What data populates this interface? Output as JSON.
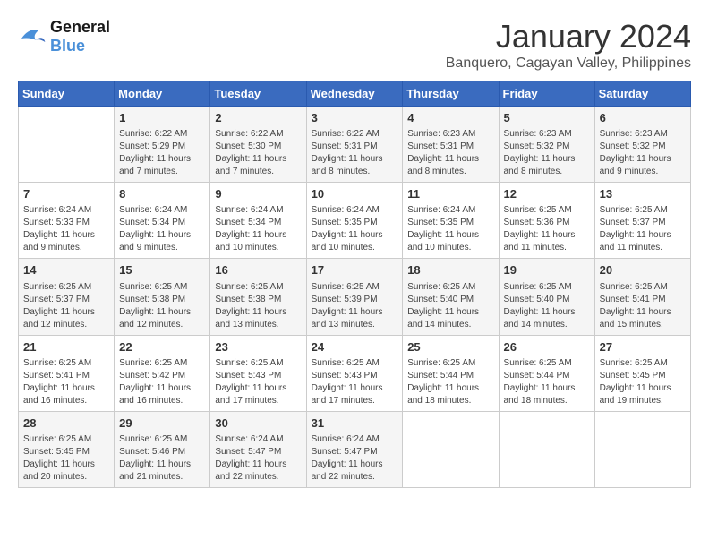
{
  "header": {
    "logo_line1": "General",
    "logo_line2": "Blue",
    "month_year": "January 2024",
    "location": "Banquero, Cagayan Valley, Philippines"
  },
  "columns": [
    "Sunday",
    "Monday",
    "Tuesday",
    "Wednesday",
    "Thursday",
    "Friday",
    "Saturday"
  ],
  "weeks": [
    [
      {
        "day": "",
        "sunrise": "",
        "sunset": "",
        "daylight": ""
      },
      {
        "day": "1",
        "sunrise": "Sunrise: 6:22 AM",
        "sunset": "Sunset: 5:29 PM",
        "daylight": "Daylight: 11 hours and 7 minutes."
      },
      {
        "day": "2",
        "sunrise": "Sunrise: 6:22 AM",
        "sunset": "Sunset: 5:30 PM",
        "daylight": "Daylight: 11 hours and 7 minutes."
      },
      {
        "day": "3",
        "sunrise": "Sunrise: 6:22 AM",
        "sunset": "Sunset: 5:31 PM",
        "daylight": "Daylight: 11 hours and 8 minutes."
      },
      {
        "day": "4",
        "sunrise": "Sunrise: 6:23 AM",
        "sunset": "Sunset: 5:31 PM",
        "daylight": "Daylight: 11 hours and 8 minutes."
      },
      {
        "day": "5",
        "sunrise": "Sunrise: 6:23 AM",
        "sunset": "Sunset: 5:32 PM",
        "daylight": "Daylight: 11 hours and 8 minutes."
      },
      {
        "day": "6",
        "sunrise": "Sunrise: 6:23 AM",
        "sunset": "Sunset: 5:32 PM",
        "daylight": "Daylight: 11 hours and 9 minutes."
      }
    ],
    [
      {
        "day": "7",
        "sunrise": "Sunrise: 6:24 AM",
        "sunset": "Sunset: 5:33 PM",
        "daylight": "Daylight: 11 hours and 9 minutes."
      },
      {
        "day": "8",
        "sunrise": "Sunrise: 6:24 AM",
        "sunset": "Sunset: 5:34 PM",
        "daylight": "Daylight: 11 hours and 9 minutes."
      },
      {
        "day": "9",
        "sunrise": "Sunrise: 6:24 AM",
        "sunset": "Sunset: 5:34 PM",
        "daylight": "Daylight: 11 hours and 10 minutes."
      },
      {
        "day": "10",
        "sunrise": "Sunrise: 6:24 AM",
        "sunset": "Sunset: 5:35 PM",
        "daylight": "Daylight: 11 hours and 10 minutes."
      },
      {
        "day": "11",
        "sunrise": "Sunrise: 6:24 AM",
        "sunset": "Sunset: 5:35 PM",
        "daylight": "Daylight: 11 hours and 10 minutes."
      },
      {
        "day": "12",
        "sunrise": "Sunrise: 6:25 AM",
        "sunset": "Sunset: 5:36 PM",
        "daylight": "Daylight: 11 hours and 11 minutes."
      },
      {
        "day": "13",
        "sunrise": "Sunrise: 6:25 AM",
        "sunset": "Sunset: 5:37 PM",
        "daylight": "Daylight: 11 hours and 11 minutes."
      }
    ],
    [
      {
        "day": "14",
        "sunrise": "Sunrise: 6:25 AM",
        "sunset": "Sunset: 5:37 PM",
        "daylight": "Daylight: 11 hours and 12 minutes."
      },
      {
        "day": "15",
        "sunrise": "Sunrise: 6:25 AM",
        "sunset": "Sunset: 5:38 PM",
        "daylight": "Daylight: 11 hours and 12 minutes."
      },
      {
        "day": "16",
        "sunrise": "Sunrise: 6:25 AM",
        "sunset": "Sunset: 5:38 PM",
        "daylight": "Daylight: 11 hours and 13 minutes."
      },
      {
        "day": "17",
        "sunrise": "Sunrise: 6:25 AM",
        "sunset": "Sunset: 5:39 PM",
        "daylight": "Daylight: 11 hours and 13 minutes."
      },
      {
        "day": "18",
        "sunrise": "Sunrise: 6:25 AM",
        "sunset": "Sunset: 5:40 PM",
        "daylight": "Daylight: 11 hours and 14 minutes."
      },
      {
        "day": "19",
        "sunrise": "Sunrise: 6:25 AM",
        "sunset": "Sunset: 5:40 PM",
        "daylight": "Daylight: 11 hours and 14 minutes."
      },
      {
        "day": "20",
        "sunrise": "Sunrise: 6:25 AM",
        "sunset": "Sunset: 5:41 PM",
        "daylight": "Daylight: 11 hours and 15 minutes."
      }
    ],
    [
      {
        "day": "21",
        "sunrise": "Sunrise: 6:25 AM",
        "sunset": "Sunset: 5:41 PM",
        "daylight": "Daylight: 11 hours and 16 minutes."
      },
      {
        "day": "22",
        "sunrise": "Sunrise: 6:25 AM",
        "sunset": "Sunset: 5:42 PM",
        "daylight": "Daylight: 11 hours and 16 minutes."
      },
      {
        "day": "23",
        "sunrise": "Sunrise: 6:25 AM",
        "sunset": "Sunset: 5:43 PM",
        "daylight": "Daylight: 11 hours and 17 minutes."
      },
      {
        "day": "24",
        "sunrise": "Sunrise: 6:25 AM",
        "sunset": "Sunset: 5:43 PM",
        "daylight": "Daylight: 11 hours and 17 minutes."
      },
      {
        "day": "25",
        "sunrise": "Sunrise: 6:25 AM",
        "sunset": "Sunset: 5:44 PM",
        "daylight": "Daylight: 11 hours and 18 minutes."
      },
      {
        "day": "26",
        "sunrise": "Sunrise: 6:25 AM",
        "sunset": "Sunset: 5:44 PM",
        "daylight": "Daylight: 11 hours and 18 minutes."
      },
      {
        "day": "27",
        "sunrise": "Sunrise: 6:25 AM",
        "sunset": "Sunset: 5:45 PM",
        "daylight": "Daylight: 11 hours and 19 minutes."
      }
    ],
    [
      {
        "day": "28",
        "sunrise": "Sunrise: 6:25 AM",
        "sunset": "Sunset: 5:45 PM",
        "daylight": "Daylight: 11 hours and 20 minutes."
      },
      {
        "day": "29",
        "sunrise": "Sunrise: 6:25 AM",
        "sunset": "Sunset: 5:46 PM",
        "daylight": "Daylight: 11 hours and 21 minutes."
      },
      {
        "day": "30",
        "sunrise": "Sunrise: 6:24 AM",
        "sunset": "Sunset: 5:47 PM",
        "daylight": "Daylight: 11 hours and 22 minutes."
      },
      {
        "day": "31",
        "sunrise": "Sunrise: 6:24 AM",
        "sunset": "Sunset: 5:47 PM",
        "daylight": "Daylight: 11 hours and 22 minutes."
      },
      {
        "day": "",
        "sunrise": "",
        "sunset": "",
        "daylight": ""
      },
      {
        "day": "",
        "sunrise": "",
        "sunset": "",
        "daylight": ""
      },
      {
        "day": "",
        "sunrise": "",
        "sunset": "",
        "daylight": ""
      }
    ]
  ]
}
